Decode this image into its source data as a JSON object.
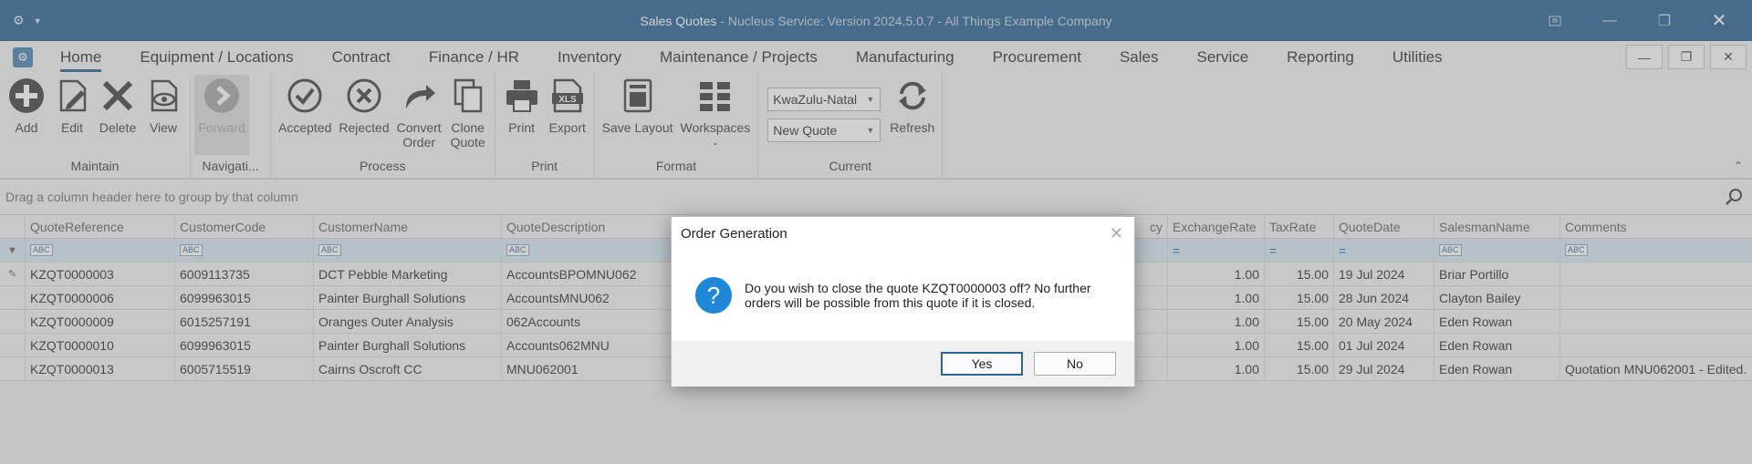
{
  "window": {
    "title_main": "Sales Quotes",
    "title_sub": " - Nucleus Service: Version 2024.5.0.7 - All Things Example Company"
  },
  "ribbon_tabs": [
    "Home",
    "Equipment / Locations",
    "Contract",
    "Finance / HR",
    "Inventory",
    "Maintenance / Projects",
    "Manufacturing",
    "Procurement",
    "Sales",
    "Service",
    "Reporting",
    "Utilities"
  ],
  "ribbon": {
    "maintain": {
      "label": "Maintain",
      "add": "Add",
      "edit": "Edit",
      "delete": "Delete",
      "view": "View"
    },
    "navigation": {
      "label": "Navigati...",
      "forward": "Forward"
    },
    "process": {
      "label": "Process",
      "accepted": "Accepted",
      "rejected": "Rejected",
      "convert_1": "Convert",
      "convert_2": "Order",
      "clone_1": "Clone",
      "clone_2": "Quote"
    },
    "print": {
      "label": "Print",
      "print": "Print",
      "export": "Export"
    },
    "format": {
      "label": "Format",
      "save_layout": "Save Layout",
      "workspaces": "Workspaces"
    },
    "current": {
      "label": "Current",
      "region": "KwaZulu-Natal",
      "status": "New Quote",
      "refresh": "Refresh"
    }
  },
  "group_panel_text": "Drag a column header here to group by that column",
  "grid": {
    "columns": [
      "QuoteReference",
      "CustomerCode",
      "CustomerName",
      "QuoteDescription",
      "cy",
      "ExchangeRate",
      "TaxRate",
      "QuoteDate",
      "SalesmanName",
      "Comments"
    ],
    "filter_icon_text": "ABC",
    "rows": [
      [
        "KZQT0000003",
        "6009113735",
        "DCT Pebble Marketing",
        "AccountsBPOMNU062",
        "",
        "1.00",
        "15.00",
        "19 Jul 2024",
        "Briar Portillo",
        ""
      ],
      [
        "KZQT0000006",
        "6099963015",
        "Painter Burghall Solutions",
        "AccountsMNU062",
        "",
        "1.00",
        "15.00",
        "28 Jun 2024",
        "Clayton Bailey",
        ""
      ],
      [
        "KZQT0000009",
        "6015257191",
        "Oranges Outer Analysis",
        "062Accounts",
        "",
        "1.00",
        "15.00",
        "20 May 2024",
        "Eden Rowan",
        ""
      ],
      [
        "KZQT0000010",
        "6099963015",
        "Painter Burghall Solutions",
        "Accounts062MNU",
        "",
        "1.00",
        "15.00",
        "01 Jul 2024",
        "Eden Rowan",
        ""
      ],
      [
        "KZQT0000013",
        "6005715519",
        "Cairns Oscroft CC",
        "MNU062001",
        "",
        "1.00",
        "15.00",
        "29 Jul 2024",
        "Eden Rowan",
        "Quotation MNU062001 - Edited."
      ]
    ]
  },
  "dialog": {
    "title": "Order Generation",
    "message_line1": "Do you wish to close the quote KZQT0000003 off? No further",
    "message_line2": "orders will be possible from this quote if it is closed.",
    "yes": "Yes",
    "no": "No"
  },
  "colors": {
    "titlebar": "#2b6596",
    "accent": "#1e88d6",
    "filter_row": "#d8eaf3"
  }
}
